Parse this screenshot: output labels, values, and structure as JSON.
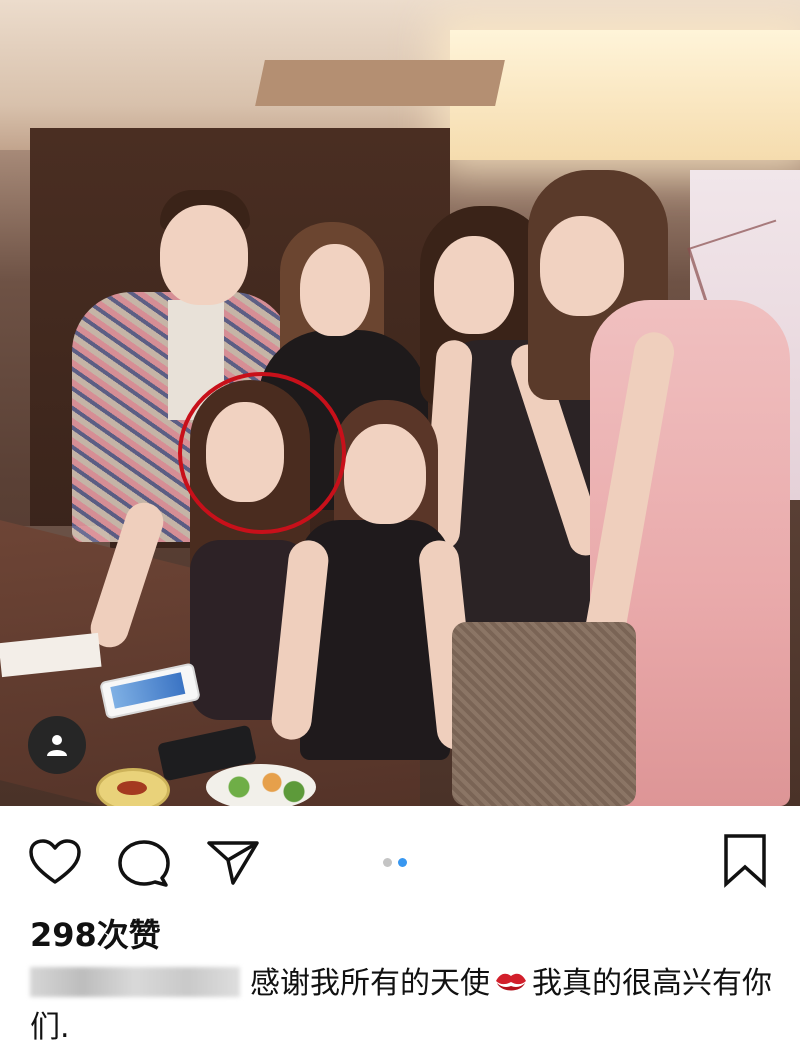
{
  "post": {
    "likes_text": "298次赞",
    "caption_text": "感谢我所有的天使",
    "caption_text_after_emoji": "我真的很高兴有你们.",
    "caption_emoji": "kiss-mark-icon",
    "carousel": {
      "count": 2,
      "active_index": 1
    }
  },
  "colors": {
    "highlight_circle": "#c8101a",
    "carousel_active": "#3897f0",
    "carousel_inactive": "#c4c4c4",
    "icon_stroke": "#111111"
  },
  "icons": {
    "like": "heart-icon",
    "comment": "comment-bubble-icon",
    "share": "paper-plane-icon",
    "save": "bookmark-icon",
    "tag": "person-tag-icon"
  }
}
